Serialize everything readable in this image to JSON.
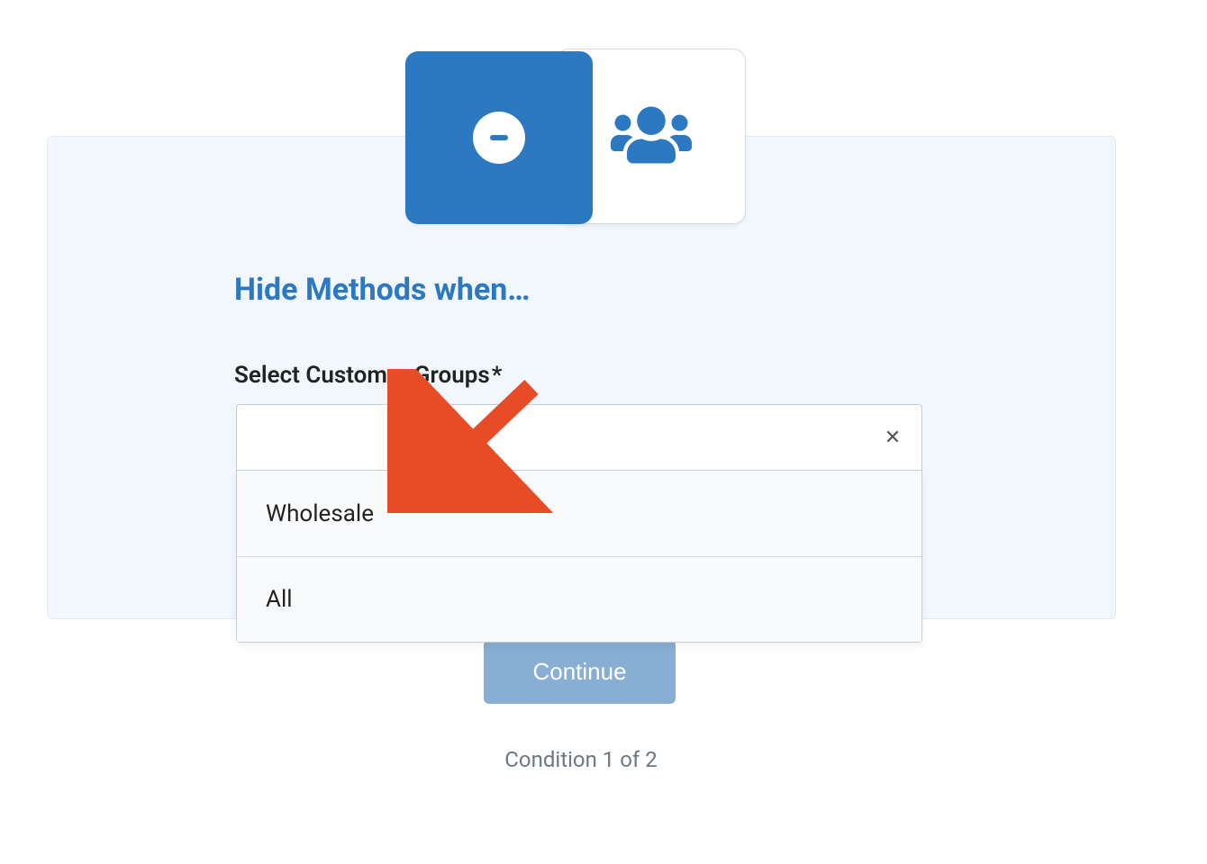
{
  "heading": "Hide Methods when…",
  "field": {
    "label": "Select Customer Groups",
    "required_mark": "*",
    "options": [
      "Wholesale",
      "All"
    ]
  },
  "continue_label": "Continue",
  "progress_text": "Condition 1 of 2",
  "icons": {
    "primary": "minus-circle-icon",
    "secondary": "group-icon",
    "clear": "close-icon"
  },
  "colors": {
    "accent": "#2c79c2",
    "accent_light": "#89aed3",
    "panel_bg": "#f1f7fc",
    "arrow": "#e84c27"
  }
}
